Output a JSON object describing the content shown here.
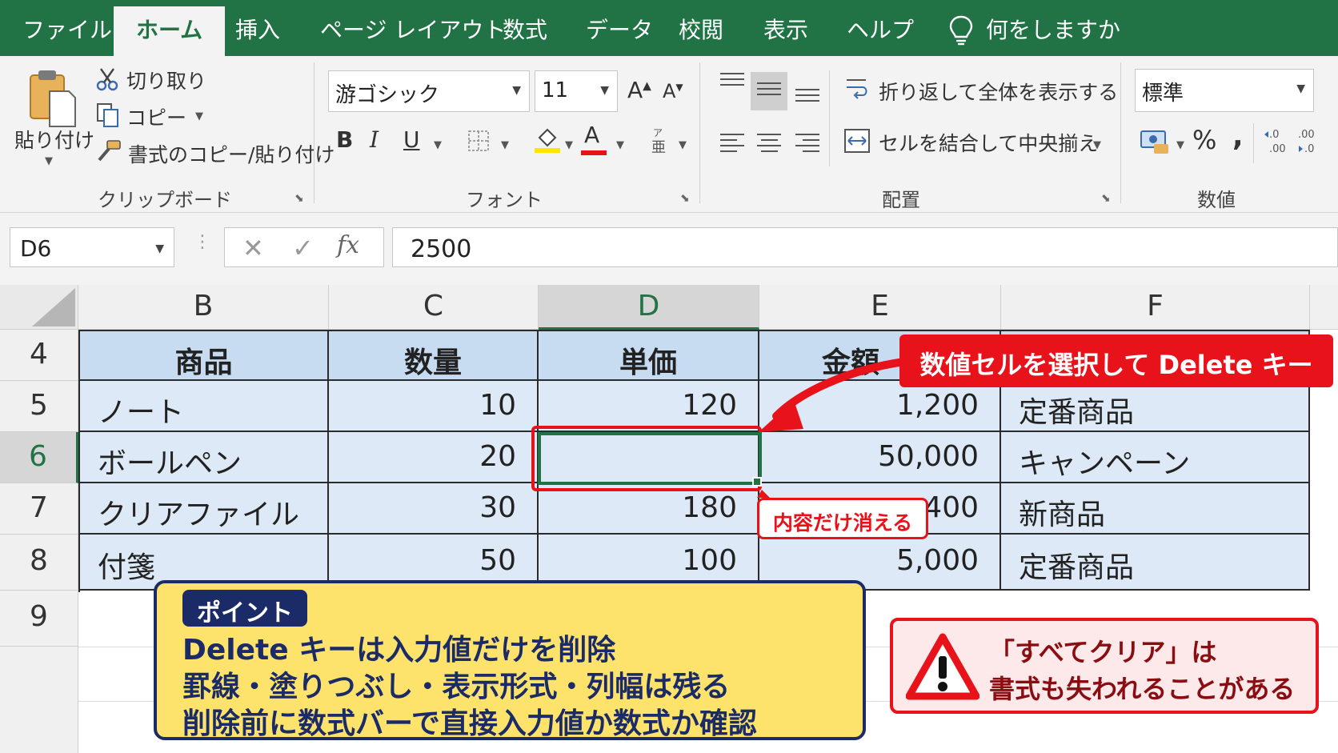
{
  "menu": {
    "tabs": [
      "ファイル",
      "ホーム",
      "挿入",
      "ページ レイアウト",
      "数式",
      "データ",
      "校閲",
      "表示",
      "ヘルプ"
    ],
    "active_tab": "ホーム",
    "tell_me": "何をしますか"
  },
  "ribbon": {
    "clipboard": {
      "paste": "貼り付け",
      "cut": "切り取り",
      "copy": "コピー",
      "format_painter": "書式のコピー/貼り付け",
      "label": "クリップボード"
    },
    "font": {
      "name": "游ゴシック",
      "size": "11",
      "grow": "A",
      "shrink": "A",
      "bold": "B",
      "italic": "I",
      "underline": "U",
      "font_color_letter": "A",
      "label": "フォント"
    },
    "alignment": {
      "wrap_text": "折り返して全体を表示する",
      "merge_center": "セルを結合して中央揃え",
      "label": "配置"
    },
    "number": {
      "format": "標準",
      "percent": "%",
      "comma": ",",
      "label": "数値"
    }
  },
  "formula_bar": {
    "name_box": "D6",
    "fx": "fx",
    "value": "2500"
  },
  "sheet": {
    "columns": [
      "B",
      "C",
      "D",
      "E",
      "F"
    ],
    "selected_column": "D",
    "rows": [
      "4",
      "5",
      "6",
      "7",
      "8",
      "9"
    ],
    "selected_row": "6",
    "header": [
      "商品",
      "数量",
      "単価",
      "金額"
    ],
    "data": [
      {
        "product": "ノート",
        "qty": "10",
        "price": "120",
        "amount": "1,200",
        "note": "定番商品"
      },
      {
        "product": "ボールペン",
        "qty": "20",
        "price": "",
        "amount": "50,000",
        "note": "キャンペーン"
      },
      {
        "product": "クリアファイル",
        "qty": "30",
        "price": "180",
        "amount": ",400",
        "note": "新商品"
      },
      {
        "product": "付箋",
        "qty": "50",
        "price": "100",
        "amount": "5,000",
        "note": "定番商品"
      }
    ]
  },
  "annotations": {
    "callout_top": "数値セルを選択して Delete キー",
    "callout_small": "内容だけ消える",
    "point_tag": "ポイント",
    "point_lines": [
      "Delete キーは入力値だけを削除",
      "罫線・塗りつぶし・表示形式・列幅は残る",
      "削除前に数式バーで直接入力値か数式か確認"
    ],
    "warning_lines": [
      "「すべてクリア」は",
      "書式も失われることがある"
    ]
  },
  "colors": {
    "excel_green": "#217346",
    "accent_red": "#e8121b",
    "table_fill": "#dde9f6",
    "header_fill": "#c7dcf0",
    "point_yellow": "#fde36b",
    "point_navy": "#1b2b68"
  }
}
